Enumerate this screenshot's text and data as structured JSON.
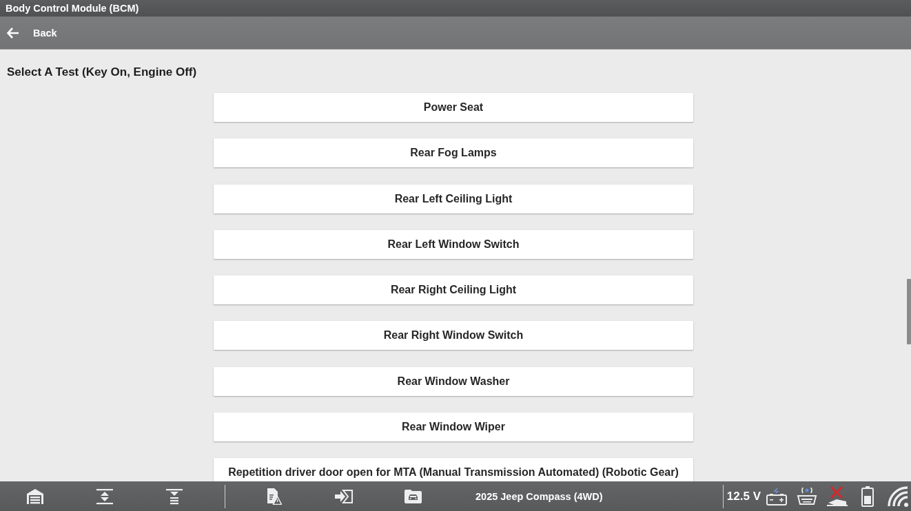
{
  "window": {
    "title": "Body Control Module (BCM)"
  },
  "nav": {
    "back_label": "Back"
  },
  "heading": "Select A Test (Key On, Engine Off)",
  "tests": [
    {
      "label": "Power Seat"
    },
    {
      "label": "Rear Fog Lamps"
    },
    {
      "label": "Rear Left Ceiling Light"
    },
    {
      "label": "Rear Left Window Switch"
    },
    {
      "label": "Rear Right Ceiling Light"
    },
    {
      "label": "Rear Right Window Switch"
    },
    {
      "label": "Rear Window Washer"
    },
    {
      "label": "Rear Window Wiper"
    },
    {
      "label": "Repetition driver door open for MTA (Manual Transmission Automated) (Robotic Gear)"
    }
  ],
  "status_bar": {
    "vehicle": "2025 Jeep Compass (4WD)",
    "voltage": "12.5 V"
  }
}
